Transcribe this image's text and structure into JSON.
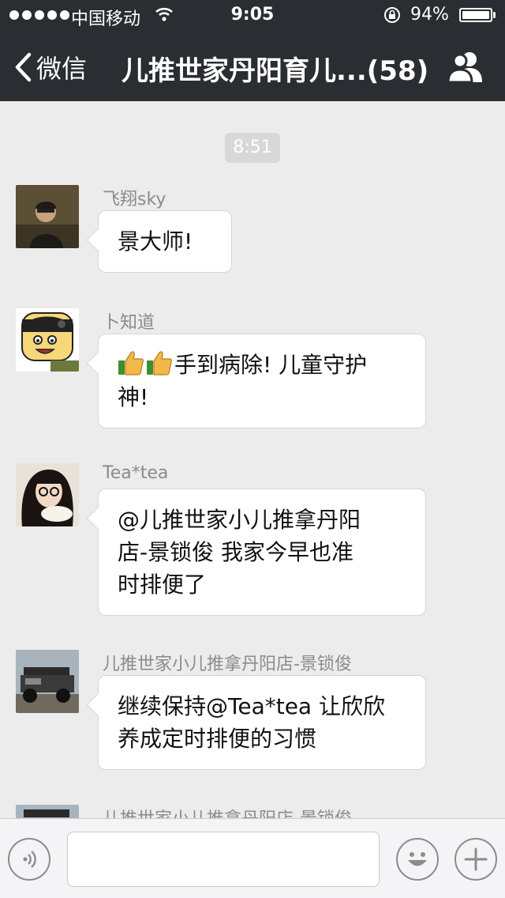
{
  "status_bar": {
    "carrier": "中国移动",
    "time": "9:05",
    "battery_percent": "94%",
    "battery_level": 0.94
  },
  "nav": {
    "back_label": "微信",
    "title": "儿推世家丹阳育儿...(58)"
  },
  "chat": {
    "timestamp": "8:51",
    "messages": [
      {
        "sender": "飞翔sky",
        "lines": [
          "景大师!"
        ]
      },
      {
        "sender": "卜知道",
        "lines": [
          "手到病除! 儿童守护",
          "神!"
        ]
      },
      {
        "sender": "Tea*tea",
        "lines": [
          "@儿推世家小儿推拿丹阳",
          "店-景锁俊 我家今早也准",
          "时排便了"
        ]
      },
      {
        "sender": "儿推世家小儿推拿丹阳店-景锁俊",
        "lines": [
          "继续保持@Tea*tea 让欣欣",
          "养成定时排便的习惯"
        ]
      },
      {
        "sender": "儿推世家小儿推拿丹阳店-景锁俊",
        "lines": []
      }
    ]
  },
  "icons": {
    "back": "chevron-left-icon",
    "group": "group-members-icon",
    "voice": "voice-input-icon",
    "emoji": "emoji-icon",
    "more": "plus-icon"
  },
  "colors": {
    "nav_bg": "#2a2d31",
    "chat_bg": "#ececec",
    "bubble_bg": "#ffffff"
  }
}
